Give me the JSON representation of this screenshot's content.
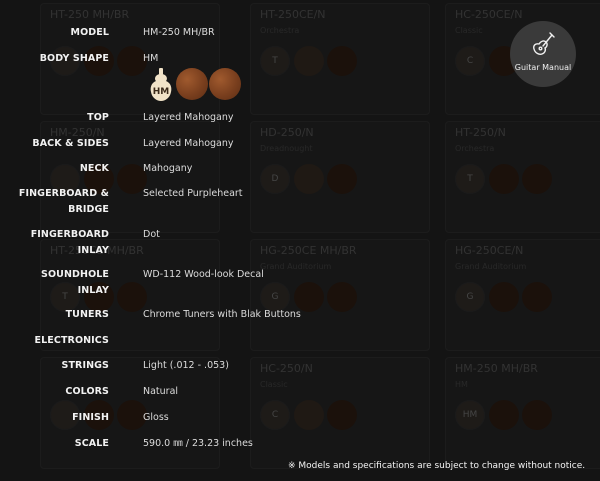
{
  "background_cards": [
    {
      "name": "HT-250 MH/BR",
      "sub": "",
      "badge": "",
      "col": 0,
      "row": 0
    },
    {
      "name": "HT-250CE/N",
      "sub": "Orchestra",
      "badge": "T",
      "col": 1,
      "row": 0
    },
    {
      "name": "HC-250CE/N",
      "sub": "Classic",
      "badge": "C",
      "col": 2,
      "row": 0
    },
    {
      "name": "HM-250/N",
      "sub": "",
      "badge": "",
      "col": 0,
      "row": 1
    },
    {
      "name": "HD-250/N",
      "sub": "Dreadnought",
      "badge": "D",
      "col": 1,
      "row": 1
    },
    {
      "name": "HT-250/N",
      "sub": "Orchestra",
      "badge": "T",
      "col": 2,
      "row": 1
    },
    {
      "name": "HT-250CE MH/BR",
      "sub": "",
      "badge": "T",
      "col": 0,
      "row": 2
    },
    {
      "name": "HG-250CE MH/BR",
      "sub": "Grand Auditorium",
      "badge": "G",
      "col": 1,
      "row": 2
    },
    {
      "name": "HG-250CE/N",
      "sub": "Grand Auditorium",
      "badge": "G",
      "col": 2,
      "row": 2
    },
    {
      "name": "",
      "sub": "",
      "badge": "",
      "col": 0,
      "row": 3
    },
    {
      "name": "HC-250/N",
      "sub": "Classic",
      "badge": "C",
      "col": 1,
      "row": 3
    },
    {
      "name": "HM-250 MH/BR",
      "sub": "HM",
      "badge": "HM",
      "col": 2,
      "row": 3
    }
  ],
  "specs": [
    {
      "label": "MODEL",
      "value": "HM-250 MH/BR"
    },
    {
      "label": "BODY SHAPE",
      "value": "HM"
    },
    {
      "label": "TOP",
      "value": "Layered Mahogany"
    },
    {
      "label": "BACK & SIDES",
      "value": "Layered Mahogany"
    },
    {
      "label": "NECK",
      "value": "Mahogany"
    },
    {
      "label": "FINGERBOARD &",
      "label2": "BRIDGE",
      "value": "Selected Purpleheart"
    },
    {
      "label": "FINGERBOARD",
      "label2": "INLAY",
      "value": "Dot"
    },
    {
      "label": "SOUNDHOLE",
      "label2": "INLAY",
      "value": "WD-112 Wood-look Decal"
    },
    {
      "label": "TUNERS",
      "value": "Chrome Tuners with Blak Buttons"
    },
    {
      "label": "ELECTRONICS",
      "value": ""
    },
    {
      "label": "STRINGS",
      "value": "Light (.012 - .053)"
    },
    {
      "label": "COLORS",
      "value": "Natural"
    },
    {
      "label": "FINISH",
      "value": "Gloss"
    },
    {
      "label": "SCALE",
      "value": "590.0 ㎜ / 23.23 inches"
    }
  ],
  "body_shape_icons": [
    {
      "name": "hm-shape-icon",
      "label": "HM"
    },
    {
      "name": "wood-swatch-1-icon",
      "label": ""
    },
    {
      "name": "wood-swatch-2-icon",
      "label": ""
    }
  ],
  "manual_button": {
    "label": "Guitar Manual",
    "icon": "guitar-icon"
  },
  "notice": "※ Models and specifications are subject to change without notice.",
  "colors": {
    "background": "#202020",
    "accent_wood": "#7a3f1e"
  }
}
